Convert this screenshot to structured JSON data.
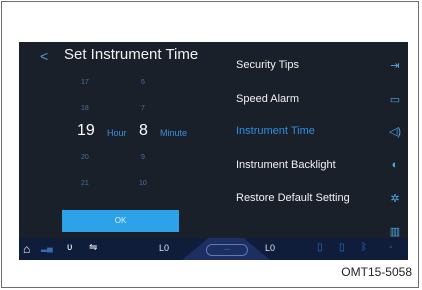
{
  "screen": {
    "title": "Set Instrument Time",
    "back_glyph": "<",
    "picker": {
      "hours_above": [
        "17",
        "18"
      ],
      "hour_selected": "19",
      "hours_below": [
        "20",
        "21"
      ],
      "hour_unit": "Hour",
      "minutes_above": [
        "6",
        "7"
      ],
      "minute_selected": "8",
      "minutes_below": [
        "9",
        "10"
      ],
      "minute_unit": "Minute"
    },
    "ok_label": "OK",
    "menu": [
      {
        "label": "Security Tips",
        "icon": "exit-icon",
        "glyph": "⇥"
      },
      {
        "label": "Speed Alarm",
        "icon": "speech-bubble-icon",
        "glyph": "▭"
      },
      {
        "label": "Instrument Time",
        "icon": "volume-icon",
        "glyph": "◁)"
      },
      {
        "label": "Instrument Backlight",
        "icon": "brightness-icon",
        "glyph": "◐"
      },
      {
        "label": "Restore Default Setting",
        "icon": "gear-icon",
        "glyph": "✲"
      },
      {
        "label": "",
        "icon": "manual-icon",
        "glyph": "▥"
      }
    ],
    "active_menu_index": 2
  },
  "status_bar": {
    "left_readout": "L0",
    "right_readout": "L0",
    "center_badge": "◦◦◦"
  },
  "caption": "OMT15-5058",
  "colors": {
    "screen_bg": "#1a2029",
    "accent": "#2d8fe0",
    "ok_button": "#2ea2e8",
    "status_bar": "#0f1d3a"
  }
}
